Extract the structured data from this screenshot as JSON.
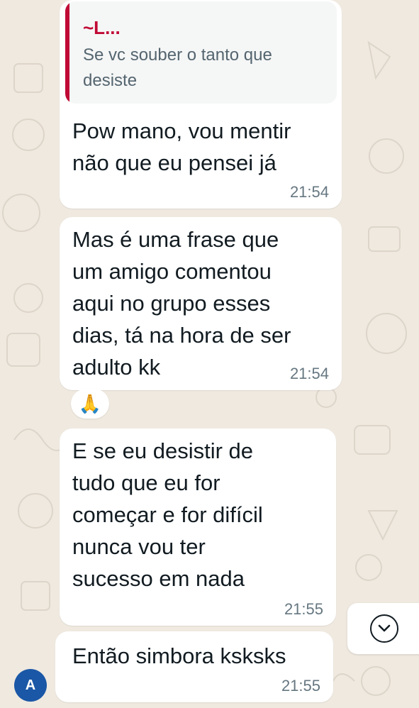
{
  "messages": [
    {
      "id": "m1",
      "quote": {
        "author": "~L...",
        "text": "Se vc souber o tanto que desiste"
      },
      "lines": [
        "Pow mano, vou mentir",
        "não que eu pensei já"
      ],
      "time": "21:54"
    },
    {
      "id": "m2",
      "lines": [
        "Mas é uma frase que",
        "um amigo comentou",
        "aqui no grupo esses",
        "dias, tá na hora de ser",
        "adulto kk"
      ],
      "time": "21:54",
      "reaction": "🙏"
    },
    {
      "id": "m3",
      "lines": [
        "E se eu desistir de",
        "tudo que eu for",
        "começar e for difícil",
        "nunca vou ter",
        "sucesso em nada"
      ],
      "time": "21:55"
    },
    {
      "id": "m4",
      "lines": [
        "Então simbora ksksks"
      ],
      "time": "21:55"
    }
  ],
  "avatar": {
    "initial": "A",
    "color": "#1a57a6"
  },
  "colors": {
    "quote_accent": "#c00a35",
    "wallpaper": "#efe9e0",
    "bubble": "#ffffff",
    "timestamp": "#667781"
  },
  "icons": {
    "scroll_down": "chevron-down-circle-icon",
    "reaction": "folded-hands-emoji"
  }
}
